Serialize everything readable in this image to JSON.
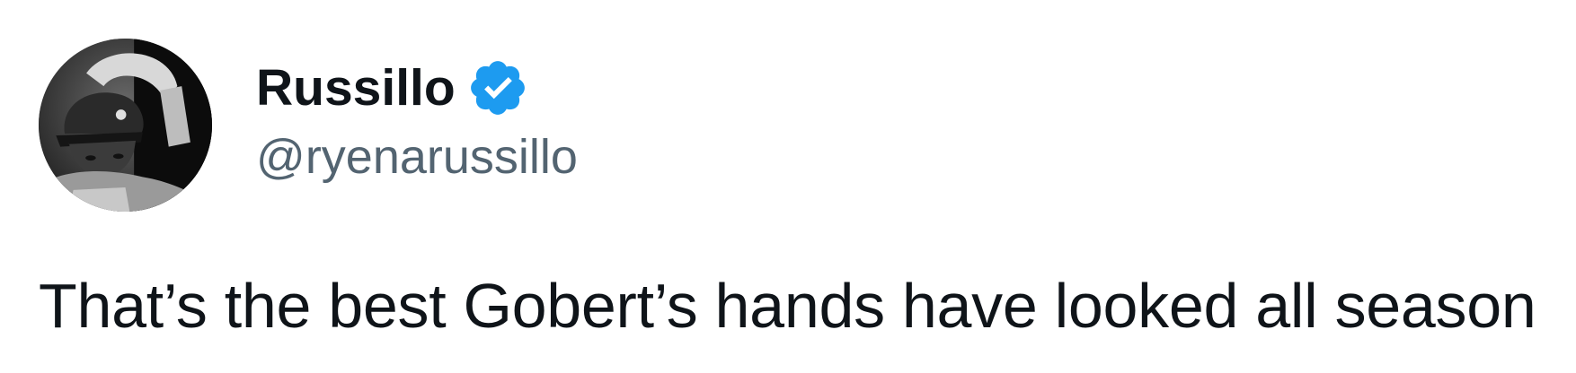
{
  "tweet": {
    "author": {
      "display_name": "Russillo",
      "handle": "@ryenarussillo",
      "verified": true,
      "verified_icon": "verified-badge-icon",
      "avatar_alt": "profile photo"
    },
    "text": "That’s the best Gobert’s hands have looked all season"
  },
  "colors": {
    "text_primary": "#0f1419",
    "text_secondary": "#536471",
    "verified_blue": "#1d9bf0",
    "background": "#ffffff"
  }
}
